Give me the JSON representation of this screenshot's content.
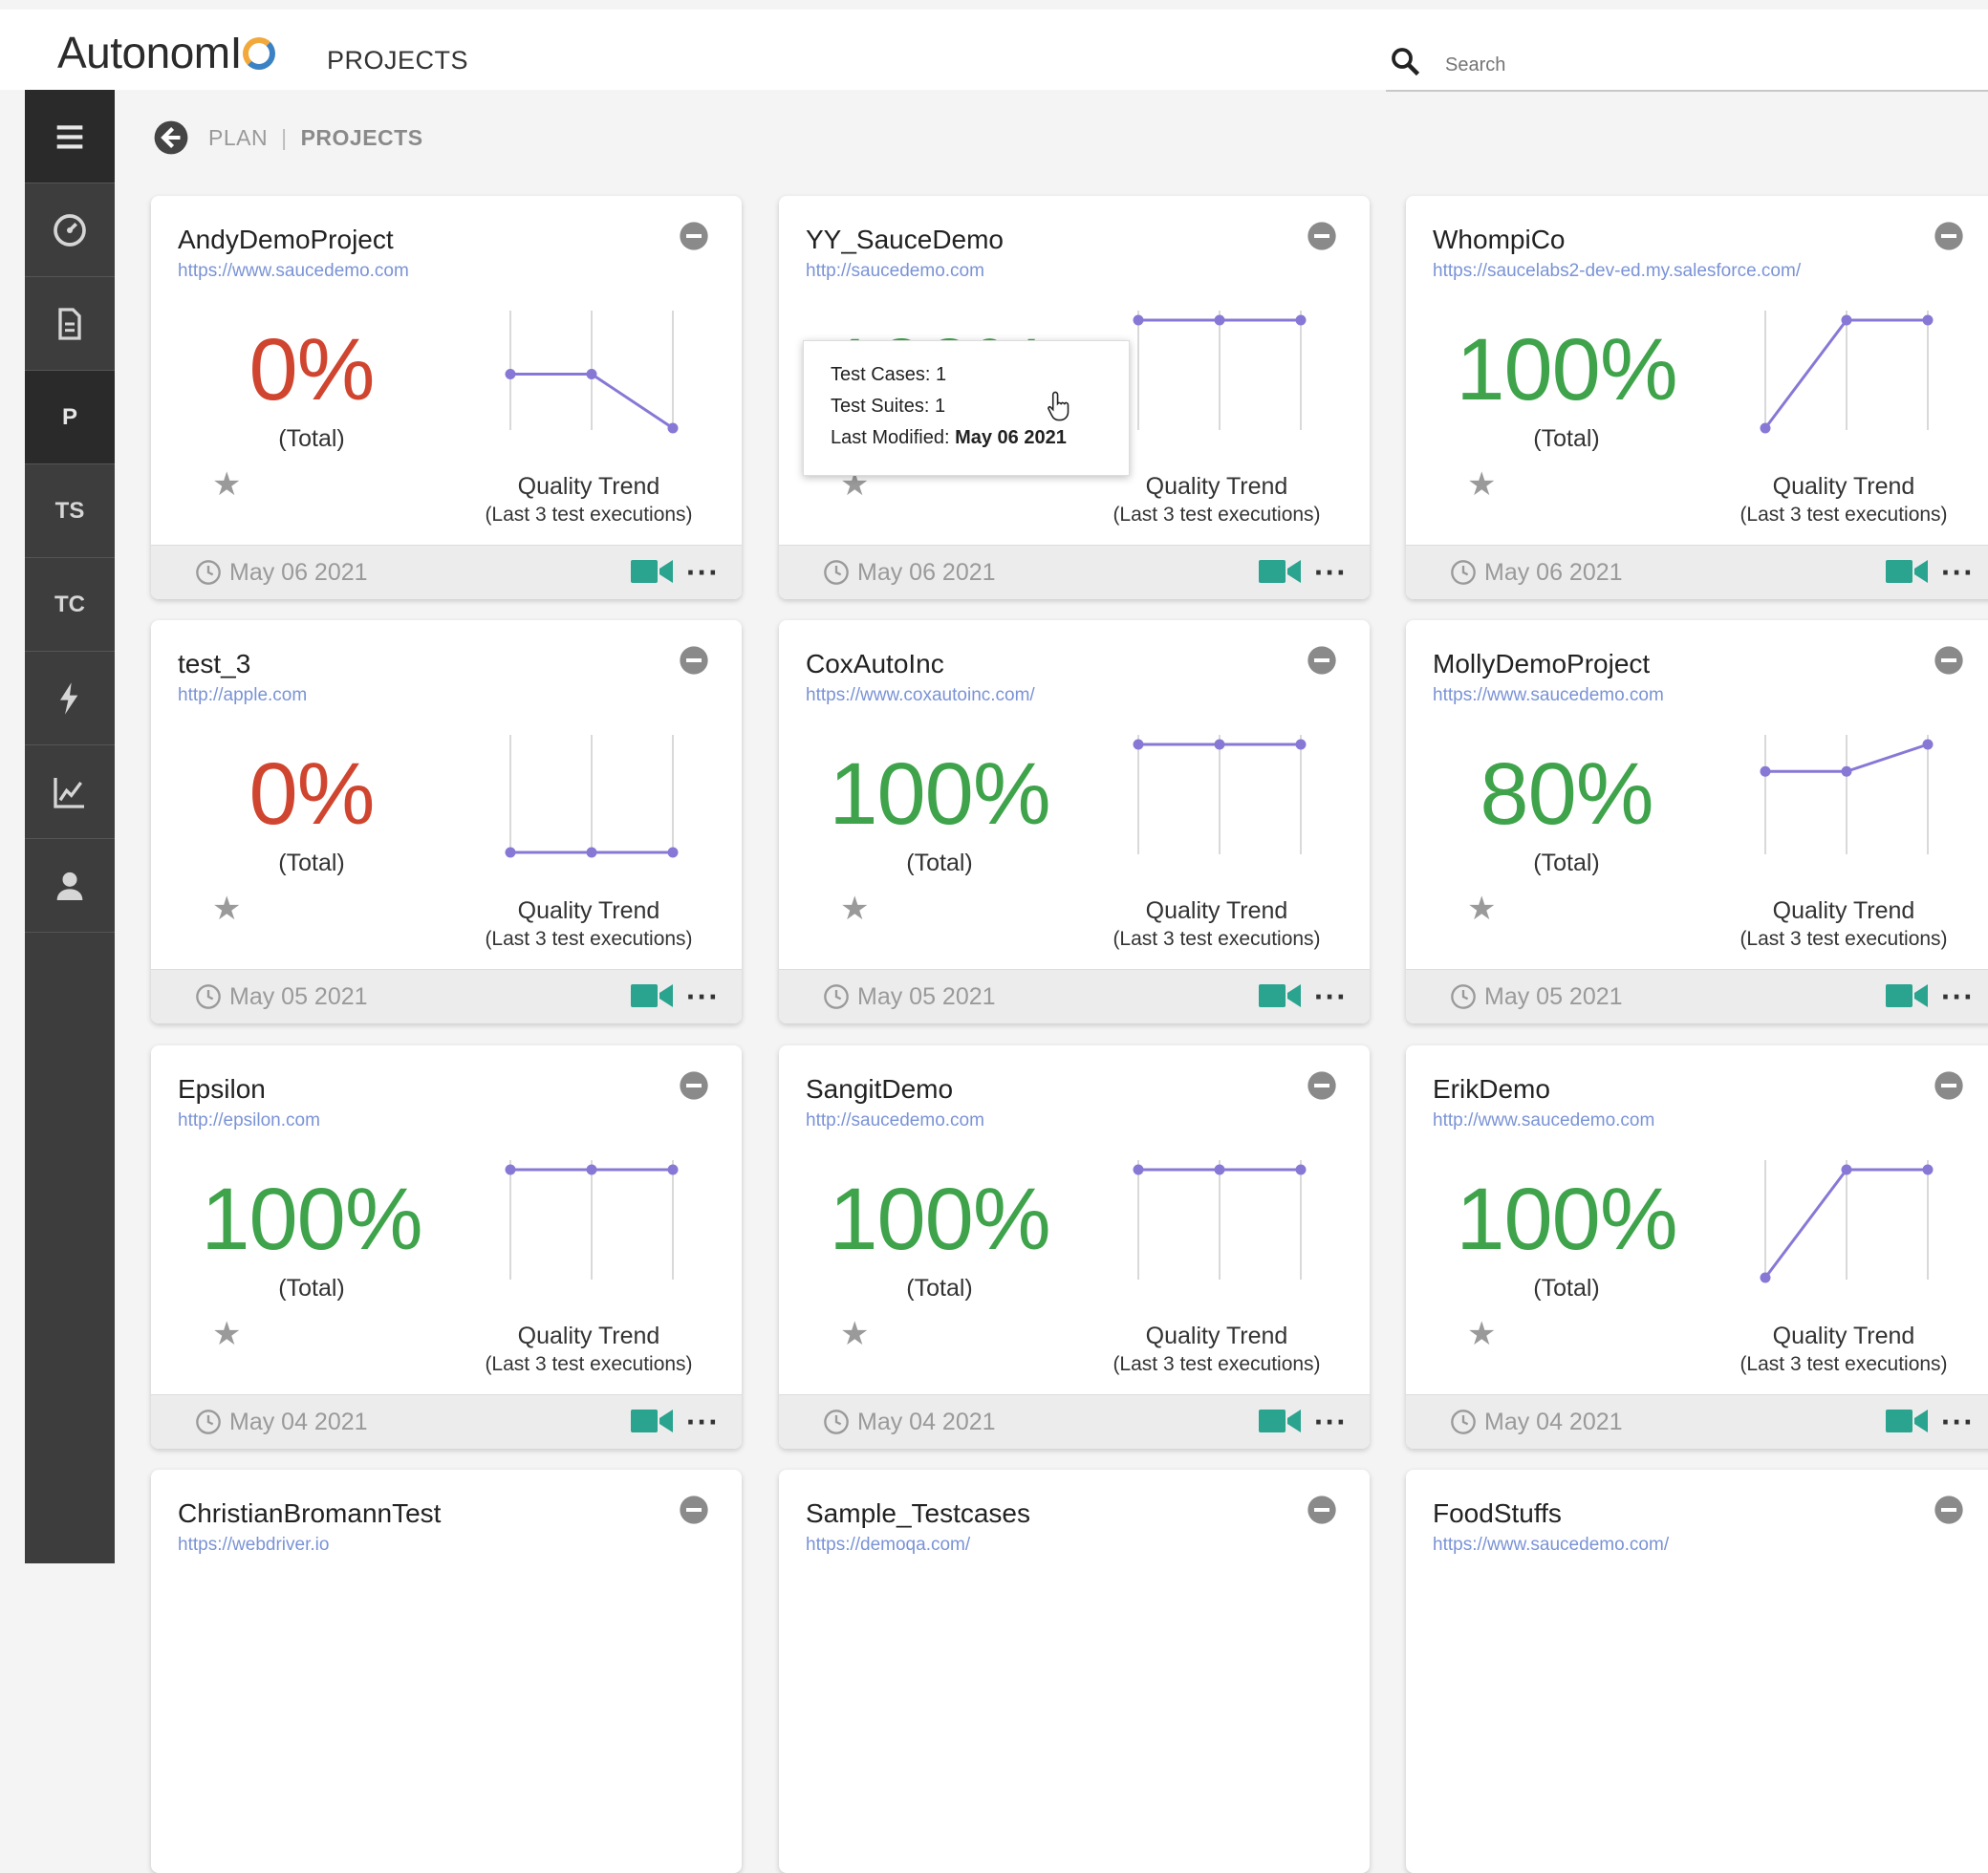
{
  "header": {
    "logo_text": "AutonomI",
    "title": "PROJECTS",
    "search_placeholder": "Search"
  },
  "sidebar": {
    "items": [
      {
        "label": "",
        "icon": "menu-icon"
      },
      {
        "label": "",
        "icon": "dashboard-icon"
      },
      {
        "label": "",
        "icon": "document-icon"
      },
      {
        "label": "P",
        "icon": ""
      },
      {
        "label": "TS",
        "icon": ""
      },
      {
        "label": "TC",
        "icon": ""
      },
      {
        "label": "",
        "icon": "bolt-icon"
      },
      {
        "label": "",
        "icon": "chart-icon"
      },
      {
        "label": "",
        "icon": "user-icon"
      }
    ]
  },
  "breadcrumb": {
    "parent": "PLAN",
    "separator": "|",
    "current": "PROJECTS"
  },
  "common": {
    "total_label": "(Total)",
    "trend_title": "Quality Trend",
    "trend_subtitle": "(Last 3 test executions)"
  },
  "colors": {
    "red": "#d0452f",
    "green": "#3ea34a",
    "trend_line": "#8878d6",
    "video": "#2aa38f"
  },
  "tooltip": {
    "test_cases_label": "Test Cases:",
    "test_cases_value": "1",
    "test_suites_label": "Test Suites:",
    "test_suites_value": "1",
    "last_modified_label": "Last Modified:",
    "last_modified_value": "May 06 2021"
  },
  "projects": [
    {
      "name": "AndyDemoProject",
      "url": "https://www.saucedemo.com",
      "percent": "0%",
      "status": "red",
      "trend": [
        50,
        50,
        0
      ],
      "date": "May 06 2021"
    },
    {
      "name": "YY_SauceDemo",
      "url": "http://saucedemo.com",
      "percent": "100%",
      "status": "green",
      "trend": [
        100,
        100,
        100
      ],
      "date": "May 06 2021"
    },
    {
      "name": "WhompiCo",
      "url": "https://saucelabs2-dev-ed.my.salesforce.com/",
      "percent": "100%",
      "status": "green",
      "trend": [
        0,
        100,
        100
      ],
      "date": "May 06 2021"
    },
    {
      "name": "test_3",
      "url": "http://apple.com",
      "percent": "0%",
      "status": "red",
      "trend": [
        0,
        0,
        0
      ],
      "date": "May 05 2021"
    },
    {
      "name": "CoxAutoInc",
      "url": "https://www.coxautoinc.com/",
      "percent": "100%",
      "status": "green",
      "trend": [
        100,
        100,
        100
      ],
      "date": "May 05 2021"
    },
    {
      "name": "MollyDemoProject",
      "url": "https://www.saucedemo.com",
      "percent": "80%",
      "status": "green",
      "trend": [
        75,
        75,
        100
      ],
      "date": "May 05 2021"
    },
    {
      "name": "Epsilon",
      "url": "http://epsilon.com",
      "percent": "100%",
      "status": "green",
      "trend": [
        100,
        100,
        100
      ],
      "date": "May 04 2021"
    },
    {
      "name": "SangitDemo",
      "url": "http://saucedemo.com",
      "percent": "100%",
      "status": "green",
      "trend": [
        100,
        100,
        100
      ],
      "date": "May 04 2021"
    },
    {
      "name": "ErikDemo",
      "url": "http://www.saucedemo.com",
      "percent": "100%",
      "status": "green",
      "trend": [
        0,
        100,
        100
      ],
      "date": "May 04 2021"
    },
    {
      "name": "ChristianBromannTest",
      "url": "https://webdriver.io",
      "percent": "",
      "status": "green",
      "trend": [],
      "date": ""
    },
    {
      "name": "Sample_Testcases",
      "url": "https://demoqa.com/",
      "percent": "",
      "status": "green",
      "trend": [],
      "date": ""
    },
    {
      "name": "FoodStuffs",
      "url": "https://www.saucedemo.com/",
      "percent": "",
      "status": "green",
      "trend": [],
      "date": ""
    }
  ]
}
